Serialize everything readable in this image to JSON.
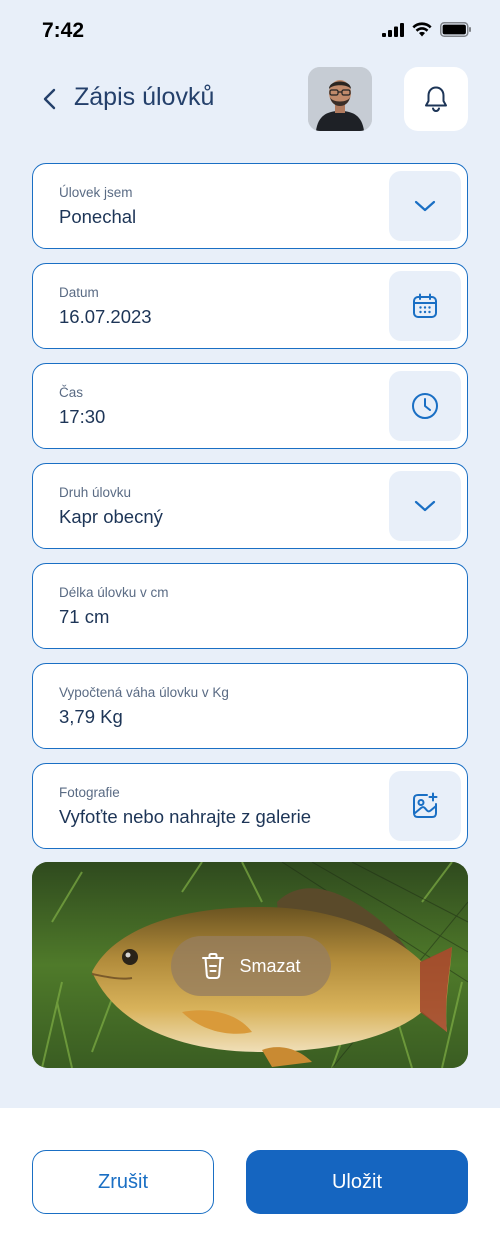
{
  "status_bar": {
    "time": "7:42"
  },
  "header": {
    "title": "Zápis úlovků"
  },
  "fields": [
    {
      "label": "Úlovek jsem",
      "value": "Ponechal",
      "action_icon": "chevron-down-icon"
    },
    {
      "label": "Datum",
      "value": "16.07.2023",
      "action_icon": "calendar-icon"
    },
    {
      "label": "Čas",
      "value": "17:30",
      "action_icon": "clock-icon"
    },
    {
      "label": "Druh úlovku",
      "value": "Kapr obecný",
      "action_icon": "chevron-down-icon"
    },
    {
      "label": "Délka úlovku v cm",
      "value": "71 cm"
    },
    {
      "label": "Vypočtená váha úlovku v Kg",
      "value": "3,79 Kg"
    },
    {
      "label": "Fotografie",
      "value": "Vyfoťte nebo nahrajte z galerie",
      "action_icon": "add-image-icon"
    }
  ],
  "photo": {
    "delete_label": "Smazat"
  },
  "footer": {
    "cancel_label": "Zrušit",
    "save_label": "Uložit"
  },
  "colors": {
    "accent": "#1565c0",
    "border": "#1a6fc4",
    "background": "#e8eff9",
    "text": "#1d3557"
  }
}
